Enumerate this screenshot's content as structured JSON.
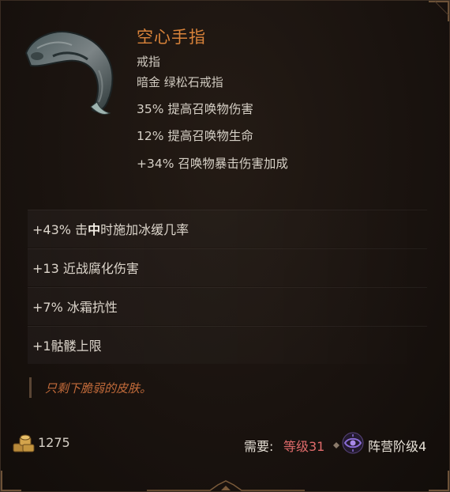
{
  "item": {
    "name": "空心手指",
    "type": "戒指",
    "subtype": "暗金  绿松石戒指",
    "implicit_stats": [
      "35% 提高召唤物伤害",
      "12% 提高召唤物生命",
      "+34% 召唤物暴击伤害加成"
    ]
  },
  "affixes": {
    "a0": {
      "pre": "+43% 击",
      "bold": "中",
      "post": "时施加冰缓几率"
    },
    "a1": "+13 近战腐化伤害",
    "a2": "+7% 冰霜抗性",
    "a3": "+1骷髅上限"
  },
  "flavor_text": "只剩下脆弱的皮肤。",
  "footer": {
    "gold": "1275",
    "gold_icon": "gold-coins-icon",
    "requirement_label": "需要:",
    "level_requirement": "等级31",
    "faction_icon": "faction-eye-icon",
    "faction_requirement": "阵营阶级4"
  },
  "colors": {
    "item_name": "#d9833a",
    "flavor": "#c36b3a",
    "level_requirement": "#e06b6b",
    "faction_icon": "#8a6cd6"
  }
}
